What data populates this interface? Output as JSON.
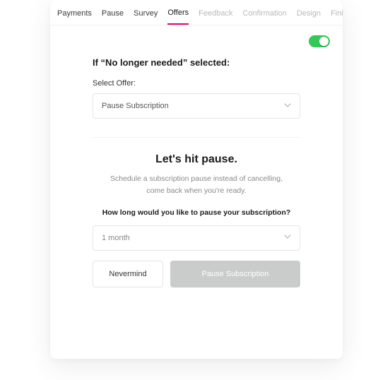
{
  "tabs": {
    "payments": "Payments",
    "pause": "Pause",
    "survey": "Survey",
    "offers": "Offers",
    "feedback": "Feedback",
    "confirmation": "Confirmation",
    "design": "Design",
    "finish": "Finish"
  },
  "toggle_on": true,
  "config": {
    "condition_title": "If “No longer needed” selected:",
    "offer_label": "Select Offer:",
    "offer_value": "Pause Subscription"
  },
  "preview": {
    "heading": "Let's hit pause.",
    "line1": "Schedule a subscription pause instead of cancelling,",
    "line2": "come back when you're ready.",
    "question": "How long would you like to pause your subscription?",
    "duration_value": "1 month",
    "cancel_btn": "Nevermind",
    "confirm_btn": "Pause Subscription"
  },
  "colors": {
    "accent": "#e6007e",
    "toggle_on": "#34c759",
    "btn_primary_bg": "#c9cccb"
  }
}
